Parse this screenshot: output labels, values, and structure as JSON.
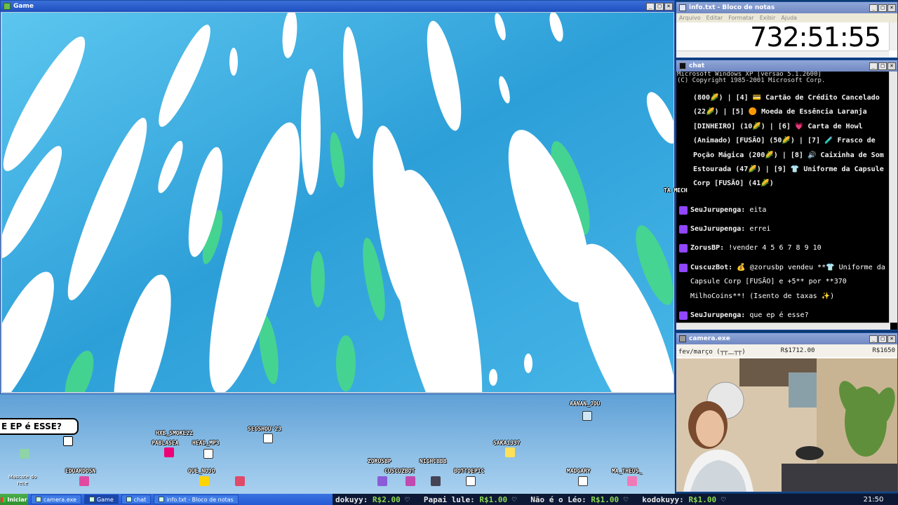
{
  "game_window": {
    "title": "Game"
  },
  "overlay": {
    "speech_bubble": "E EP é ESSE?",
    "mascot_label": "Mascote do\nrece",
    "viewers": [
      {
        "name": "HXB_SMOKE22"
      },
      {
        "name": "PABLASEA"
      },
      {
        "name": "HEAD_MP3"
      },
      {
        "name": "SEGSHOU'23"
      },
      {
        "name": "EDUARDOSN"
      },
      {
        "name": "QUE_NOJO"
      },
      {
        "name": "ZORUSBP"
      },
      {
        "name": "NIGHCBBB"
      },
      {
        "name": "CUSCUZBOT"
      },
      {
        "name": "BOTTOEPIC"
      },
      {
        "name": "SAKA1337"
      },
      {
        "name": "AANAN_JOU"
      },
      {
        "name": "MADGARY"
      },
      {
        "name": "MA_THEUS_"
      },
      {
        "name": "TA MECH"
      }
    ]
  },
  "notepad": {
    "title": "info.txt - Bloco de notas",
    "menu": [
      "Arquivo",
      "Editar",
      "Formatar",
      "Exibir",
      "Ajuda"
    ],
    "content": "732:51:55"
  },
  "chat_window": {
    "title": "chat",
    "system_lines": [
      "Microsoft Windows XP [versão 5.1.2600]",
      "(C) Copyright 1985-2001 Microsoft Corp."
    ],
    "inventory_text": "(800🌽) | [4] 💳 Cartão de Crédito Cancelado (22🌽) | [5] 🟠 Moeda de Essência Laranja [DINHEIRO] (10🌽) | [6] 💗 Carta de Howl (Animado) [FUSÃO] (50🌽) | [7] 🧪 Frasco de Poção Mágica (200🌽) | [8] 🔊 Caixinha de Som Estourada (47🌽) | [9] 👕 Uniforme da Capsule Corp [FUSÃO] (41🌽)",
    "messages": [
      {
        "user": "SeuJurupenga:",
        "text": "eita"
      },
      {
        "user": "SeuJurupenga:",
        "text": "errei"
      },
      {
        "user": "ZorusBP:",
        "text": "!vender 4 5 6 7 8 9 10"
      },
      {
        "user": "CuscuzBot:",
        "text": "💰 @zorusbp vendeu **👕 Uniforme da Capsule Corp [FUSÃO] e +5** por **370 MilhoCoins**! (Isento de taxas ✨)"
      },
      {
        "user": "SeuJurupenga:",
        "text": "que ep é esse?"
      }
    ]
  },
  "camera_window": {
    "title": "camera.exe",
    "goal_label": "fev/março (┬┬﹏┬┬)",
    "goal_current": "R$1712.00",
    "goal_target": "R$1650"
  },
  "taskbar": {
    "start_label": "Iniciar",
    "tasks": [
      {
        "label": "camera.exe",
        "active": false
      },
      {
        "label": "Game",
        "active": true
      },
      {
        "label": "chat",
        "active": false
      },
      {
        "label": "info.txt - Bloco de notas",
        "active": false
      }
    ],
    "ticker": [
      {
        "name": "dokuyy:",
        "amount": "R$2.00"
      },
      {
        "name": "Papai lule:",
        "amount": "R$1.00"
      },
      {
        "name": "Não é o Léo:",
        "amount": "R$1.00"
      },
      {
        "name": "kodokuyy:",
        "amount": "R$1.00"
      }
    ],
    "clock": "21:50"
  },
  "colors": {
    "xp_blue": "#245ad6",
    "twitch_purple": "#9146ff",
    "ticker_green": "#8cd850"
  }
}
